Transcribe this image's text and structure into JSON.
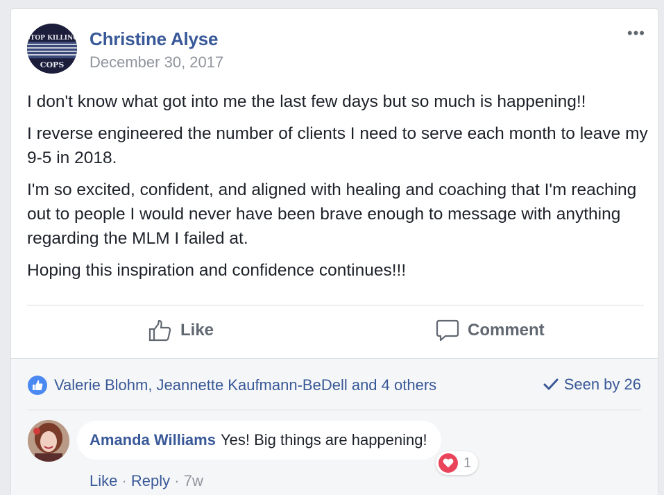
{
  "post": {
    "avatar_text_top": "STOP KILLING",
    "avatar_text_bottom": "COPS",
    "author": "Christine Alyse",
    "date": "December 30, 2017",
    "more_icon": "more-dots-icon",
    "paragraphs": [
      "I don't know what got into me the last few days but so much is happening!!",
      "I reverse engineered the number of clients I need to serve each month to leave my 9-5 in 2018.",
      "I'm so excited, confident, and aligned with healing and coaching that I'm reaching out to people I would never have been brave enough to message with anything regarding the MLM I failed at.",
      "Hoping this inspiration and confidence continues!!!"
    ]
  },
  "actions": {
    "like_label": "Like",
    "comment_label": "Comment"
  },
  "reactions": {
    "likers": "Valerie Blohm, Jeannette Kaufmann-BeDell and 4 others",
    "seen": "Seen by 26"
  },
  "comment": {
    "author": "Amanda Williams",
    "text": "Yes! Big things are happening!",
    "like_label": "Like",
    "sep1": " · ",
    "reply_label": "Reply",
    "sep2": " · ",
    "time": "7w",
    "reaction_count": "1"
  },
  "colors": {
    "link": "#385898",
    "like_badge": "#4a88f2",
    "heart": "#e9445a"
  }
}
